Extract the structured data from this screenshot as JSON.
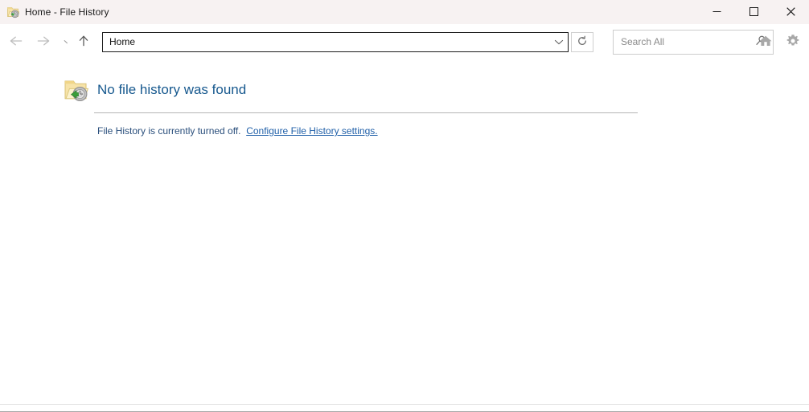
{
  "window": {
    "title": "Home - File History",
    "app_icon": "folder-history-icon",
    "controls": {
      "minimize_label": "—",
      "minimize_name": "minimize-icon",
      "maximize_label": "☐",
      "maximize_name": "maximize-icon",
      "close_label": "✕",
      "close_name": "close-icon"
    }
  },
  "toolbar": {
    "back_icon": "arrow-left-icon",
    "forward_icon": "arrow-right-icon",
    "recent_locations_icon": "chevron-down-small-icon",
    "up_icon": "arrow-up-icon",
    "address": {
      "value": "Home",
      "dropdown_icon": "chevron-down-icon"
    },
    "refresh_icon": "refresh-icon",
    "search": {
      "placeholder": "Search All",
      "value": "",
      "icon": "search-icon"
    },
    "home_icon": "home-icon",
    "settings_icon": "gear-icon"
  },
  "content": {
    "status_icon": "folder-history-large-icon",
    "heading": "No file history was found",
    "detail_text": "File History is currently turned off.",
    "configure_link": "Configure File History settings."
  },
  "colors": {
    "titlebar_bg": "#f7f2f2",
    "heading_blue": "#16588e",
    "link_blue": "#1f5fa8",
    "detail_blue": "#2a4f7c",
    "divider": "#b4b4b4",
    "address_border": "#1b1b1b",
    "search_border": "#cdcdcd",
    "folder_yellow": "#f5dfa0",
    "badge_green": "#3a9e3a"
  }
}
